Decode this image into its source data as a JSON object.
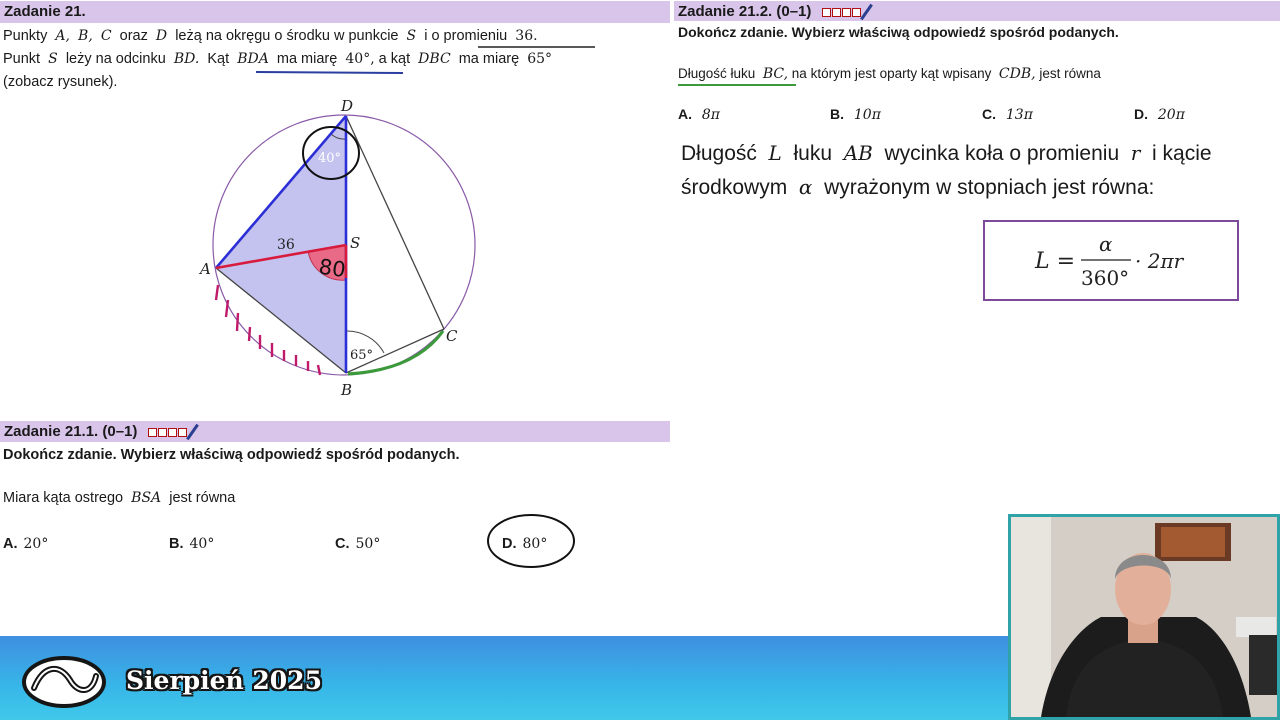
{
  "task21": {
    "header": "Zadanie 21.",
    "line1": {
      "a": "Punkty",
      "A": "A,",
      "B": "B,",
      "C": "C",
      "oraz": "oraz",
      "D": "D",
      "rest": "leżą na okręgu o środku w punkcie",
      "S": "S",
      "i": "i",
      "o_prom": "o promieniu",
      "r": "36."
    },
    "line2": {
      "a": "Punkt",
      "S": "S",
      "b": "leży na odcinku",
      "BD": "BD.",
      "c": "Kąt",
      "BDA": "BDA",
      "d": "ma miarę",
      "v1": "40°,",
      "e": "a kąt",
      "DBC": "DBC",
      "f": "ma miarę",
      "v2": "65°"
    },
    "line3": "(zobacz rysunek).",
    "figure": {
      "D": "D",
      "A": "A",
      "S": "S",
      "B": "B",
      "C": "C",
      "angle_D": "40°",
      "radius": "36",
      "angle_S": "80",
      "angle_B": "65°"
    }
  },
  "task21_1": {
    "header": "Zadanie 21.1. (0–1)",
    "instruction": "Dokończ zdanie. Wybierz właściwą odpowiedź spośród podanych.",
    "question_prefix": "Miara kąta ostrego",
    "question_var": "BSA",
    "question_suffix": "jest równa",
    "options": [
      {
        "letter": "A.",
        "value": "20°"
      },
      {
        "letter": "B.",
        "value": "40°"
      },
      {
        "letter": "C.",
        "value": "50°"
      },
      {
        "letter": "D.",
        "value": "80°"
      }
    ]
  },
  "task21_2": {
    "header": "Zadanie 21.2. (0–1)",
    "instruction": "Dokończ zdanie. Wybierz właściwą odpowiedź spośród podanych.",
    "q_a": "Długość łuku",
    "q_BC": "BC,",
    "q_b": "na którym jest oparty kąt wpisany",
    "q_CDB": "CDB,",
    "q_c": "jest równa",
    "options": [
      {
        "letter": "A.",
        "value": "8π"
      },
      {
        "letter": "B.",
        "value": "10π"
      },
      {
        "letter": "C.",
        "value": "13π"
      },
      {
        "letter": "D.",
        "value": "20π"
      }
    ],
    "note_l1": {
      "a": "Długość",
      "L": "L",
      "b": "łuku",
      "AB": "AB",
      "c": "wycinka koła o promieniu",
      "r": "r",
      "d": "i kącie"
    },
    "note_l2": {
      "a": "środkowym",
      "alpha": "α",
      "b": "wyrażonym w stopniach jest równa:"
    },
    "formula": {
      "lhs": "L =",
      "num": "α",
      "den": "360°",
      "rhs": "· 2πr"
    }
  },
  "footer": {
    "title": "Sierpień 2025"
  },
  "colors": {
    "header_bg": "#d9c4ea",
    "footer": "#3fa9e6",
    "triangle_fill": "#c4c3f0",
    "circle": "#8a5aa8"
  }
}
